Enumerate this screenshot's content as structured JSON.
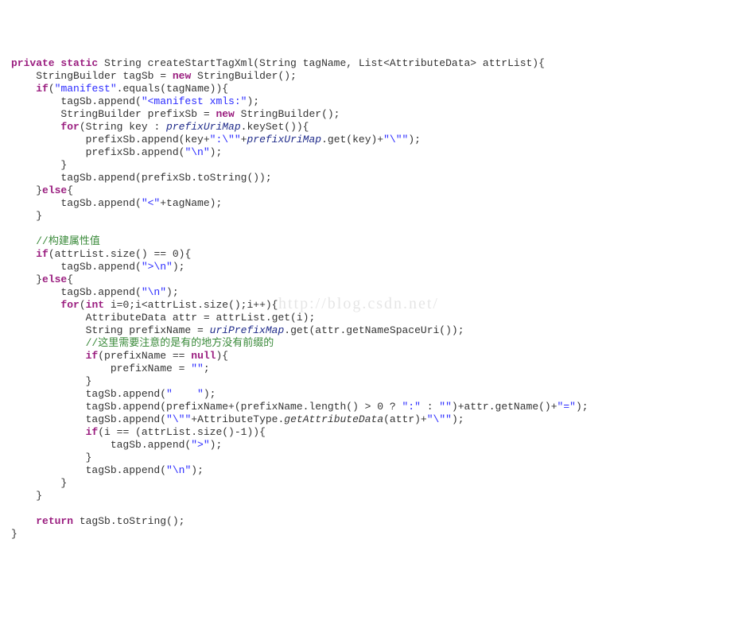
{
  "watermark": "http://blog.csdn.net/",
  "code": {
    "l1": {
      "kw1": "private static",
      "t1": " String createStartTagXml(String tagName, List<AttributeData> attrList){"
    },
    "l2": {
      "t1": "    StringBuilder tagSb = ",
      "kw1": "new",
      "t2": " StringBuilder();"
    },
    "l3": {
      "t1": "    ",
      "kw1": "if",
      "t2": "(",
      "s1": "\"manifest\"",
      "t3": ".equals(tagName)){"
    },
    "l4": {
      "t1": "        tagSb.append(",
      "s1": "\"<manifest xmls:\"",
      "t2": ");"
    },
    "l5": {
      "t1": "        StringBuilder prefixSb = ",
      "kw1": "new",
      "t2": " StringBuilder();"
    },
    "l6": {
      "t1": "        ",
      "kw1": "for",
      "t2": "(String key : ",
      "it1": "prefixUriMap",
      "t3": ".keySet()){"
    },
    "l7": {
      "t1": "            prefixSb.append(key+",
      "s1": "\":\\\"\"",
      "t2": "+",
      "it1": "prefixUriMap",
      "t3": ".get(key)+",
      "s2": "\"\\\"\"",
      "t4": ");"
    },
    "l8": {
      "t1": "            prefixSb.append(",
      "s1": "\"\\n\"",
      "t2": ");"
    },
    "l9": {
      "t1": "        }"
    },
    "l10": {
      "t1": "        tagSb.append(prefixSb.toString());"
    },
    "l11": {
      "t1": "    }",
      "kw1": "else",
      "t2": "{"
    },
    "l12": {
      "t1": "        tagSb.append(",
      "s1": "\"<\"",
      "t2": "+tagName);"
    },
    "l13": {
      "t1": "    }"
    },
    "l14": {
      "t1": "    "
    },
    "l15": {
      "t1": "    ",
      "c1": "//构建属性值"
    },
    "l16": {
      "t1": "    ",
      "kw1": "if",
      "t2": "(attrList.size() == 0){"
    },
    "l17": {
      "t1": "        tagSb.append(",
      "s1": "\">\\n\"",
      "t2": ");"
    },
    "l18": {
      "t1": "    }",
      "kw1": "else",
      "t2": "{"
    },
    "l19": {
      "t1": "        tagSb.append(",
      "s1": "\"\\n\"",
      "t2": ");"
    },
    "l20": {
      "t1": "        ",
      "kw1": "for",
      "t2": "(",
      "kw2": "int",
      "t3": " i=0;i<attrList.size();i++){"
    },
    "l21": {
      "t1": "            AttributeData attr = attrList.get(i);"
    },
    "l22": {
      "t1": "            String prefixName = ",
      "it1": "uriPrefixMap",
      "t2": ".get(attr.getNameSpaceUri());"
    },
    "l23": {
      "t1": "            ",
      "c1": "//这里需要注意的是有的地方没有前缀的"
    },
    "l24": {
      "t1": "            ",
      "kw1": "if",
      "t2": "(prefixName == ",
      "kw2": "null",
      "t3": "){"
    },
    "l25": {
      "t1": "                prefixName = ",
      "s1": "\"\"",
      "t2": ";"
    },
    "l26": {
      "t1": "            }"
    },
    "l27": {
      "t1": "            tagSb.append(",
      "s1": "\"    \"",
      "t2": ");"
    },
    "l28": {
      "t1": "            tagSb.append(prefixName+(prefixName.length() > 0 ? ",
      "s1": "\":\"",
      "t2": " : ",
      "s2": "\"\"",
      "t3": ")+attr.getName()+",
      "s3": "\"=\"",
      "t4": ");"
    },
    "l29": {
      "t1": "            tagSb.append(",
      "s1": "\"\\\"\"",
      "t2": "+AttributeType.",
      "it1": "getAttributeData",
      "t3": "(attr)+",
      "s2": "\"\\\"\"",
      "t4": ");"
    },
    "l30": {
      "t1": "            ",
      "kw1": "if",
      "t2": "(i == (attrList.size()-1)){"
    },
    "l31": {
      "t1": "                tagSb.append(",
      "s1": "\">\"",
      "t2": ");"
    },
    "l32": {
      "t1": "            }"
    },
    "l33": {
      "t1": "            tagSb.append(",
      "s1": "\"\\n\"",
      "t2": ");"
    },
    "l34": {
      "t1": "        }"
    },
    "l35": {
      "t1": "    }"
    },
    "l36": {
      "t1": "    "
    },
    "l37": {
      "t1": "    ",
      "kw1": "return",
      "t2": " tagSb.toString();"
    },
    "l38": {
      "t1": "}"
    }
  }
}
